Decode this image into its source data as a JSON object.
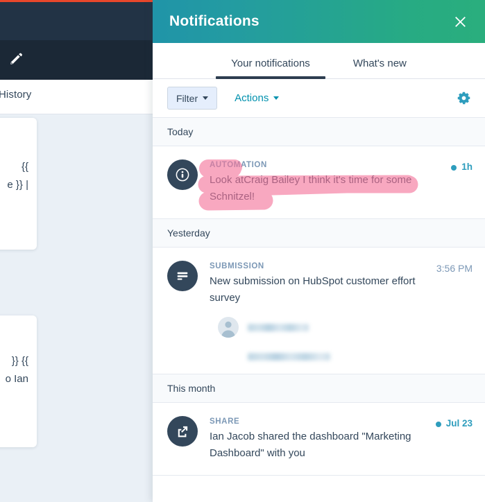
{
  "background_app": {
    "accent_color": "#e8472b",
    "navbar_color": "#223345",
    "subbar_color": "#1b2836",
    "pencil_icon": "pencil-icon",
    "history_tab_label": "History",
    "card_1_text": "{{\n}} |",
    "card_1_line_1": "{{",
    "card_1_line_2": "e }} |",
    "card_2_line_1": "}} {{",
    "card_2_line_2": "o Ian"
  },
  "panel": {
    "title": "Notifications",
    "close_icon": "close-icon",
    "header_gradient_from": "#2094a8",
    "header_gradient_to": "#2aae7d",
    "tabs": [
      {
        "label": "Your notifications",
        "active": true
      },
      {
        "label": "What's new",
        "active": false
      }
    ],
    "toolbar": {
      "filter_label": "Filter",
      "actions_label": "Actions",
      "settings_icon": "gear-icon",
      "settings_color": "#2e9dbd",
      "actions_color": "#0091ae"
    },
    "groups": [
      {
        "header": "Today",
        "items": [
          {
            "icon": "info-icon",
            "kind": "AUTOMATION",
            "text": "Look atCraig Bailey I think it's time for some Schnitzel!",
            "time": "1h",
            "unread": true,
            "highlighted": true
          }
        ]
      },
      {
        "header": "Yesterday",
        "items": [
          {
            "icon": "form-submission-icon",
            "kind": "SUBMISSION",
            "text": "New submission on HubSpot customer effort survey",
            "time": "3:56 PM",
            "unread": false,
            "highlighted": false,
            "detail": {
              "avatar_icon": "person-avatar-icon",
              "name_redacted": true,
              "line_2_redacted": true
            }
          }
        ]
      },
      {
        "header": "This month",
        "items": [
          {
            "icon": "external-link-icon",
            "kind": "SHARE",
            "text": "Ian Jacob shared the dashboard \"Marketing Dashboard\" with you",
            "time": "Jul 23",
            "unread": true,
            "highlighted": false
          }
        ]
      }
    ],
    "annotation": {
      "type": "pink-highlighter",
      "color": "#f9a3bb",
      "targets": [
        "AUTOMATION",
        "Look atCraig Bailey I think it's time for some",
        "Schnitzel!"
      ]
    }
  }
}
